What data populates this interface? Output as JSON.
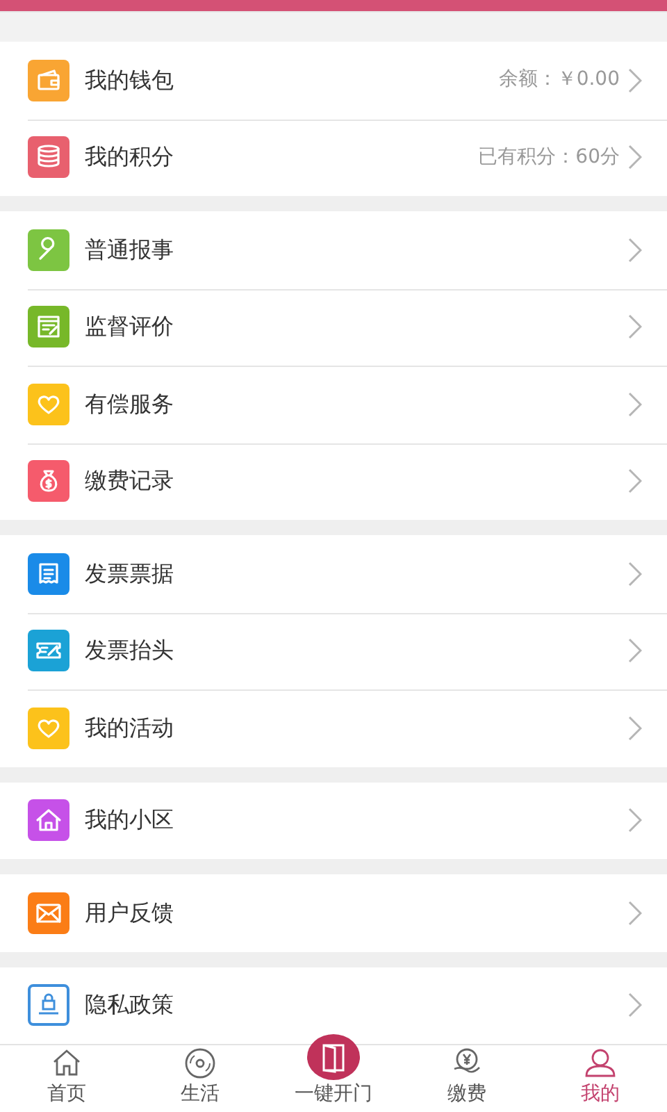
{
  "groups": [
    {
      "items": [
        {
          "label": "我的钱包",
          "value": "余额：￥0.00",
          "color": "#f9a533"
        },
        {
          "label": "我的积分",
          "value": "已有积分：60分",
          "color": "#e8606e"
        }
      ]
    },
    {
      "items": [
        {
          "label": "普通报事",
          "color": "#7dc542"
        },
        {
          "label": "监督评价",
          "color": "#77b829"
        },
        {
          "label": "有偿服务",
          "color": "#fcc21b"
        },
        {
          "label": "缴费记录",
          "color": "#f55b6c"
        }
      ]
    },
    {
      "items": [
        {
          "label": "发票票据",
          "color": "#1a8be8"
        },
        {
          "label": "发票抬头",
          "color": "#1ba2d6"
        },
        {
          "label": "我的活动",
          "color": "#fcc21b"
        }
      ]
    },
    {
      "items": [
        {
          "label": "我的小区",
          "color": "#c651e8"
        }
      ]
    },
    {
      "items": [
        {
          "label": "用户反馈",
          "color": "#fb7d16"
        }
      ]
    },
    {
      "items": [
        {
          "label": "隐私政策",
          "color": "#3e8fdc",
          "kind": "outline"
        }
      ]
    }
  ],
  "tab_bar": [
    {
      "label": "首页",
      "selected": false,
      "kind": "tab"
    },
    {
      "label": "生活",
      "selected": false,
      "kind": "tab"
    },
    {
      "label": "一键开门",
      "selected": false,
      "kind": "center"
    },
    {
      "label": "缴费",
      "selected": false,
      "kind": "tab"
    },
    {
      "label": "我的",
      "selected": true,
      "kind": "tab"
    }
  ]
}
